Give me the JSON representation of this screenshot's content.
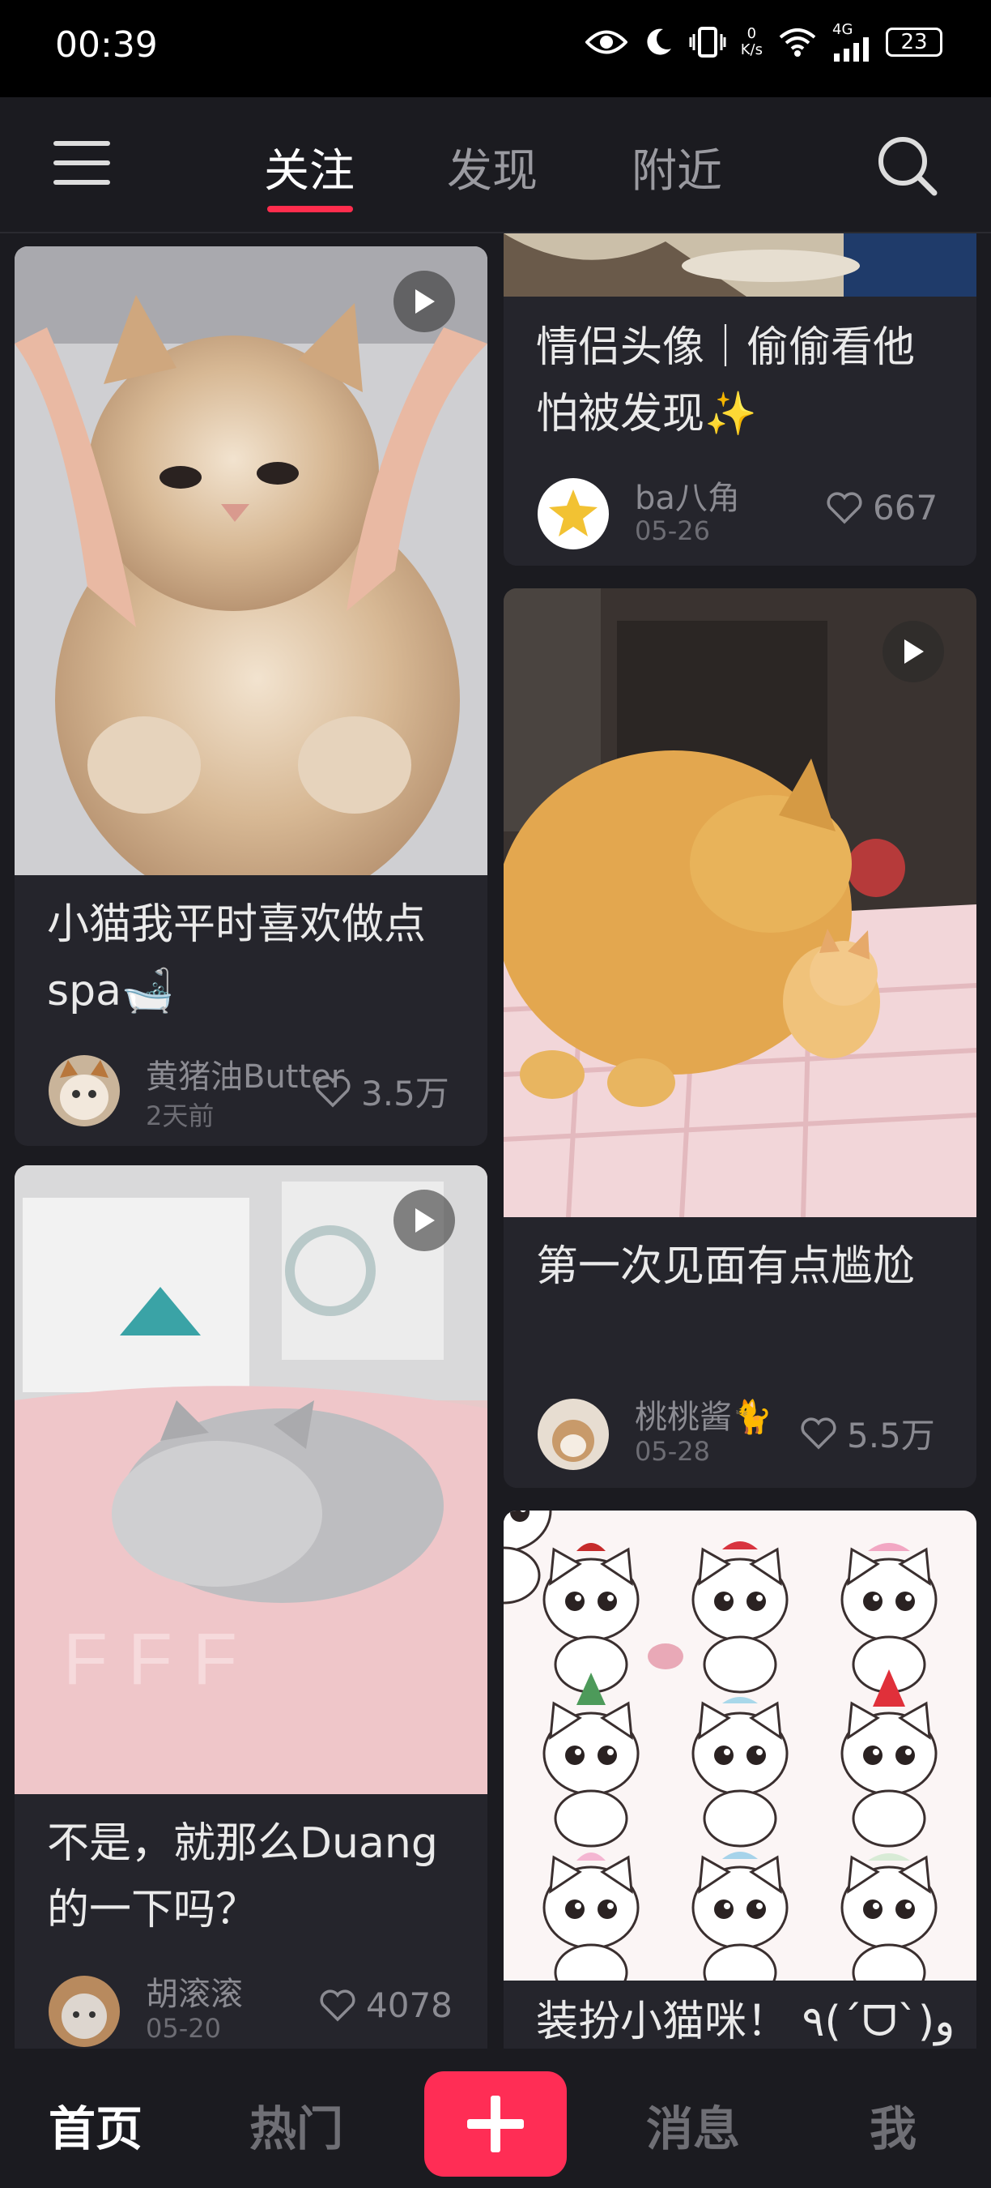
{
  "status_bar": {
    "time": "00:39",
    "speed_top": "0",
    "speed_unit": "K/s",
    "network": "4G",
    "battery": "23"
  },
  "top_nav": {
    "tabs": [
      "关注",
      "发现",
      "附近"
    ],
    "active_tab": "关注",
    "accent": "#ff2d4d"
  },
  "feed": {
    "cards": [
      {
        "title": "小猫我平时喜欢做点spa🛁",
        "author": "黄猪油Butter",
        "date": "2天前",
        "likes": "3.5万",
        "is_video": true
      },
      {
        "title": "不是，就那么Duang的一下吗？",
        "author": "胡滚滚",
        "date": "05-20",
        "likes": "4078",
        "is_video": true
      },
      {
        "title": "情侣头像｜偷偷看他 怕被发现✨",
        "author": "ba八角",
        "date": "05-26",
        "likes": "667",
        "is_video": false
      },
      {
        "title": "第一次见面有点尴尬",
        "author": "桃桃酱🐈",
        "date": "05-28",
        "likes": "5.5万",
        "is_video": true
      },
      {
        "title": "装扮小猫咪！ ٩(ˊᗜˋ)و",
        "is_video": false
      }
    ]
  },
  "bottom_nav": {
    "home": "首页",
    "hot": "热门",
    "messages": "消息",
    "me": "我",
    "plus_color": "#ff2d55"
  }
}
